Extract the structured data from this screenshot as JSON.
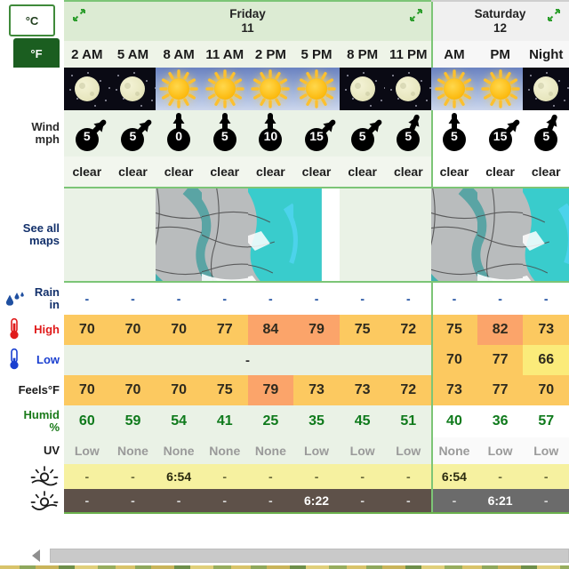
{
  "units": {
    "celsius_label": "°C",
    "fahrenheit_label": "°F",
    "selected": "°F"
  },
  "days": [
    {
      "name": "Friday",
      "date": "11",
      "columns": 8,
      "expand_icon": "expand-arrows-icon"
    },
    {
      "name": "Saturday",
      "date": "12",
      "columns": 3,
      "expand_icon": "expand-arrows-icon"
    }
  ],
  "columns": [
    {
      "time": "2 AM",
      "day": "Friday",
      "sky": "night",
      "wind_speed": "5",
      "wind_dir": "ne",
      "condition": "clear",
      "rain": "-",
      "high": "70",
      "low": "",
      "feels": "70",
      "humidity": "60",
      "uv": "Low",
      "sunrise": "-",
      "sunset": "-"
    },
    {
      "time": "5 AM",
      "day": "Friday",
      "sky": "night",
      "wind_speed": "5",
      "wind_dir": "ne",
      "condition": "clear",
      "rain": "-",
      "high": "70",
      "low": "",
      "feels": "70",
      "humidity": "59",
      "uv": "None",
      "sunrise": "-",
      "sunset": "-"
    },
    {
      "time": "8 AM",
      "day": "Friday",
      "sky": "day",
      "wind_speed": "0",
      "wind_dir": "n",
      "condition": "clear",
      "rain": "-",
      "high": "70",
      "low": "",
      "feels": "70",
      "humidity": "54",
      "uv": "None",
      "sunrise": "6:54",
      "sunset": "-"
    },
    {
      "time": "11 AM",
      "day": "Friday",
      "sky": "day",
      "wind_speed": "5",
      "wind_dir": "n",
      "condition": "clear",
      "rain": "-",
      "high": "77",
      "low": "",
      "feels": "75",
      "humidity": "41",
      "uv": "None",
      "sunrise": "-",
      "sunset": "-"
    },
    {
      "time": "2 PM",
      "day": "Friday",
      "sky": "day",
      "wind_speed": "10",
      "wind_dir": "n",
      "condition": "clear",
      "rain": "-",
      "high": "84",
      "low": "",
      "feels": "79",
      "humidity": "25",
      "uv": "None",
      "sunrise": "-",
      "sunset": "-"
    },
    {
      "time": "5 PM",
      "day": "Friday",
      "sky": "day",
      "wind_speed": "15",
      "wind_dir": "ne",
      "condition": "clear",
      "rain": "-",
      "high": "79",
      "low": "",
      "feels": "73",
      "humidity": "35",
      "uv": "Low",
      "sunrise": "-",
      "sunset": "6:22"
    },
    {
      "time": "8 PM",
      "day": "Friday",
      "sky": "night",
      "wind_speed": "5",
      "wind_dir": "ne",
      "condition": "clear",
      "rain": "-",
      "high": "75",
      "low": "",
      "feels": "73",
      "humidity": "45",
      "uv": "Low",
      "sunrise": "-",
      "sunset": "-"
    },
    {
      "time": "11 PM",
      "day": "Friday",
      "sky": "night",
      "wind_speed": "5",
      "wind_dir": "nne",
      "condition": "clear",
      "rain": "-",
      "high": "72",
      "low": "",
      "feels": "72",
      "humidity": "51",
      "uv": "Low",
      "sunrise": "-",
      "sunset": "-"
    },
    {
      "time": "AM",
      "day": "Saturday",
      "sky": "day",
      "wind_speed": "5",
      "wind_dir": "n",
      "condition": "clear",
      "rain": "-",
      "high": "75",
      "low": "70",
      "feels": "73",
      "humidity": "40",
      "uv": "None",
      "sunrise": "6:54",
      "sunset": "-"
    },
    {
      "time": "PM",
      "day": "Saturday",
      "sky": "day",
      "wind_speed": "15",
      "wind_dir": "ne",
      "condition": "clear",
      "rain": "-",
      "high": "82",
      "low": "77",
      "feels": "77",
      "humidity": "36",
      "uv": "Low",
      "sunrise": "-",
      "sunset": "6:21"
    },
    {
      "time": "Night",
      "day": "Saturday",
      "sky": "night",
      "wind_speed": "5",
      "wind_dir": "nne",
      "condition": "clear",
      "rain": "-",
      "high": "73",
      "low": "66",
      "feels": "70",
      "humidity": "57",
      "uv": "Low",
      "sunrise": "-",
      "sunset": "-"
    }
  ],
  "rows": [
    {
      "key": "wind",
      "label_line1": "Wind",
      "label_line2": "mph",
      "icon": ""
    },
    {
      "key": "maps",
      "label_line1": "See all",
      "label_line2": "maps",
      "icon": ""
    },
    {
      "key": "rain",
      "label_line1": "Rain",
      "label_line2": "in",
      "icon": "raindrops-icon"
    },
    {
      "key": "high",
      "label_line1": "High",
      "label_line2": "",
      "icon": "thermometer-hot-icon"
    },
    {
      "key": "low",
      "label_line1": "Low",
      "label_line2": "",
      "icon": "thermometer-cold-icon"
    },
    {
      "key": "feels",
      "label_line1": "Feels°F",
      "label_line2": "",
      "icon": ""
    },
    {
      "key": "humid",
      "label_line1": "Humid",
      "label_line2": "%",
      "icon": ""
    },
    {
      "key": "uv",
      "label_line1": "UV",
      "label_line2": "",
      "icon": ""
    },
    {
      "key": "sunrise",
      "label_line1": "",
      "label_line2": "",
      "icon": "sunrise-icon"
    },
    {
      "key": "sunset",
      "label_line1": "",
      "label_line2": "",
      "icon": "sunset-icon"
    }
  ],
  "low_row_friday_placeholder": "-",
  "colors": {
    "temp_warm": "#fcc960",
    "temp_hot": "#fba46a",
    "temp_mild": "#fbeb7a",
    "day_a_bg": "#eaf2e6",
    "day_b_bg": "#f7f7f7",
    "green_border": "#7cc576",
    "sunrise_bg": "#f6f1a0",
    "sunset_bg": "#5e5149",
    "humid_text": "#0f7a1c",
    "high_label": "#e01b1b",
    "low_label": "#1a3fd0",
    "unit_selected_bg": "#1b5e20"
  },
  "scrollbar": {
    "name": "horizontal-scrollbar",
    "left_arrow": "◀"
  }
}
